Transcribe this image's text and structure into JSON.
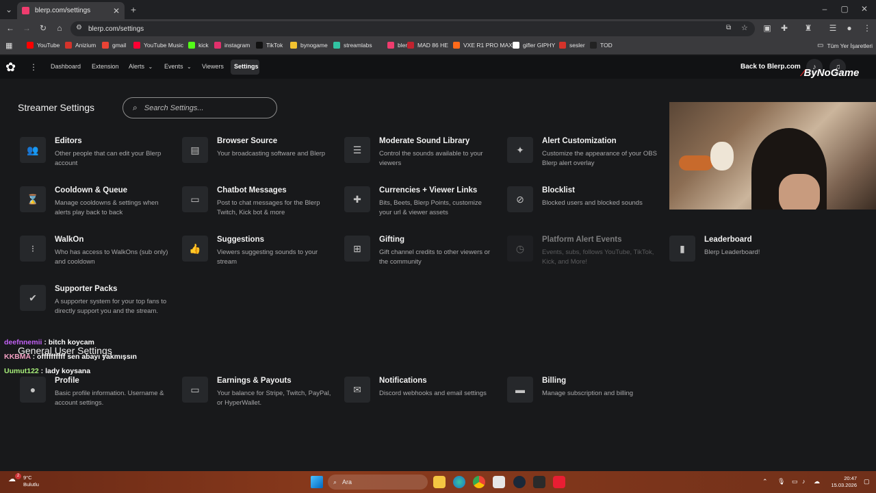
{
  "browser": {
    "tab_title": "blerp.com/settings",
    "url": "blerp.com/settings",
    "bookmarks": [
      {
        "label": "YouTube",
        "color": "#ff0000"
      },
      {
        "label": "Anizium",
        "color": "#d4332b"
      },
      {
        "label": "gmail",
        "color": "#ea4335"
      },
      {
        "label": "YouTube Music",
        "color": "#ff0033"
      },
      {
        "label": "kick",
        "color": "#53fc18"
      },
      {
        "label": "instagram",
        "color": "#e1306c"
      },
      {
        "label": "TikTok",
        "color": "#111111"
      },
      {
        "label": "bynogame",
        "color": "#f2c230"
      },
      {
        "label": "streamlabs",
        "color": "#31c3a2"
      },
      {
        "label": "blerp",
        "color": "#ef3c6e"
      },
      {
        "label": "MAD 86 HE",
        "color": "#c0232f"
      },
      {
        "label": "VXE R1 PRO MAX",
        "color": "#ff6a1a"
      },
      {
        "label": "gifler GIPHY",
        "color": "#ffffff"
      },
      {
        "label": "sesler",
        "color": "#d4332b"
      },
      {
        "label": "TOD",
        "color": "#222222"
      }
    ],
    "all_bookmarks": "Tüm Yer İşaretleri"
  },
  "nav": {
    "links": [
      "Dashboard",
      "Extension",
      "Alerts",
      "Events",
      "Viewers",
      "Settings"
    ],
    "back_label": "Back to Blerp.com"
  },
  "streamer": {
    "title": "Streamer Settings",
    "search_placeholder": "Search Settings...",
    "cards": [
      {
        "title": "Editors",
        "desc": "Other people that can edit your Blerp account",
        "icon": "group-icon"
      },
      {
        "title": "Browser Source",
        "desc": "Your broadcasting software and Blerp",
        "icon": "browser-icon"
      },
      {
        "title": "Moderate Sound Library",
        "desc": "Control the sounds available to your viewers",
        "icon": "sliders-icon"
      },
      {
        "title": "Alert Customization",
        "desc": "Customize the appearance of your OBS Blerp alert overlay",
        "icon": "magic-wand-icon"
      },
      {
        "title": "Cooldown & Queue",
        "desc": "Manage cooldowns & settings when alerts play back to back",
        "icon": "hourglass-icon"
      },
      {
        "title": "Chatbot Messages",
        "desc": "Post to chat messages for the Blerp Twitch, Kick bot & more",
        "icon": "chat-icon"
      },
      {
        "title": "Currencies + Viewer Links",
        "desc": "Bits, Beets, Blerp Points, customize your url & viewer assets",
        "icon": "puzzle-icon"
      },
      {
        "title": "Blocklist",
        "desc": "Blocked users and blocked sounds",
        "icon": "block-icon"
      },
      {
        "title": "WalkOn",
        "desc": "Who has access to WalkOns (sub only) and cooldown",
        "icon": "footsteps-icon"
      },
      {
        "title": "Suggestions",
        "desc": "Viewers suggesting sounds to your stream",
        "icon": "thumbs-up-icon"
      },
      {
        "title": "Gifting",
        "desc": "Gift channel credits to other viewers or the community",
        "icon": "gift-icon"
      },
      {
        "title": "Platform Alert Events",
        "desc": "Events, subs, follows YouTube, TikTok, Kick, and More!",
        "icon": "alarm-icon"
      },
      {
        "title": "Leaderboard",
        "desc": "Blerp Leaderboard!",
        "icon": "bar-chart-icon"
      },
      {
        "title": "Supporter Packs",
        "desc": "A supporter system for your top fans to directly support you and the stream.",
        "icon": "supporter-icon"
      }
    ]
  },
  "general": {
    "title": "General User Settings",
    "cards": [
      {
        "title": "Profile",
        "desc": "Basic profile information. Username & account settings.",
        "icon": "person-icon"
      },
      {
        "title": "Earnings & Payouts",
        "desc": "Your balance for Stripe, Twitch, PayPal, or HyperWallet.",
        "icon": "payout-icon"
      },
      {
        "title": "Notifications",
        "desc": "Discord webhooks and email settings",
        "icon": "mail-icon"
      },
      {
        "title": "Billing",
        "desc": "Manage subscription and billing",
        "icon": "credit-card-icon"
      }
    ]
  },
  "overlay": {
    "logo_text": "ByNoGame",
    "chat": [
      {
        "user": "deefnnemii",
        "msg": " : bitch koycam",
        "color": "#c261f5"
      },
      {
        "user": "KKBMA",
        "msg": " : offffffffff sen abayı yakmışsın",
        "color": "#f5a0c4"
      },
      {
        "user": "Uumut122",
        "msg": " : lady koysana",
        "color": "#a8f07a"
      }
    ]
  },
  "taskbar": {
    "weather_temp": "9°C",
    "weather_desc": "Bulutlu",
    "search_label": "Ara",
    "time": "20:47",
    "date": "15.03.2026",
    "notification_count": "2"
  }
}
